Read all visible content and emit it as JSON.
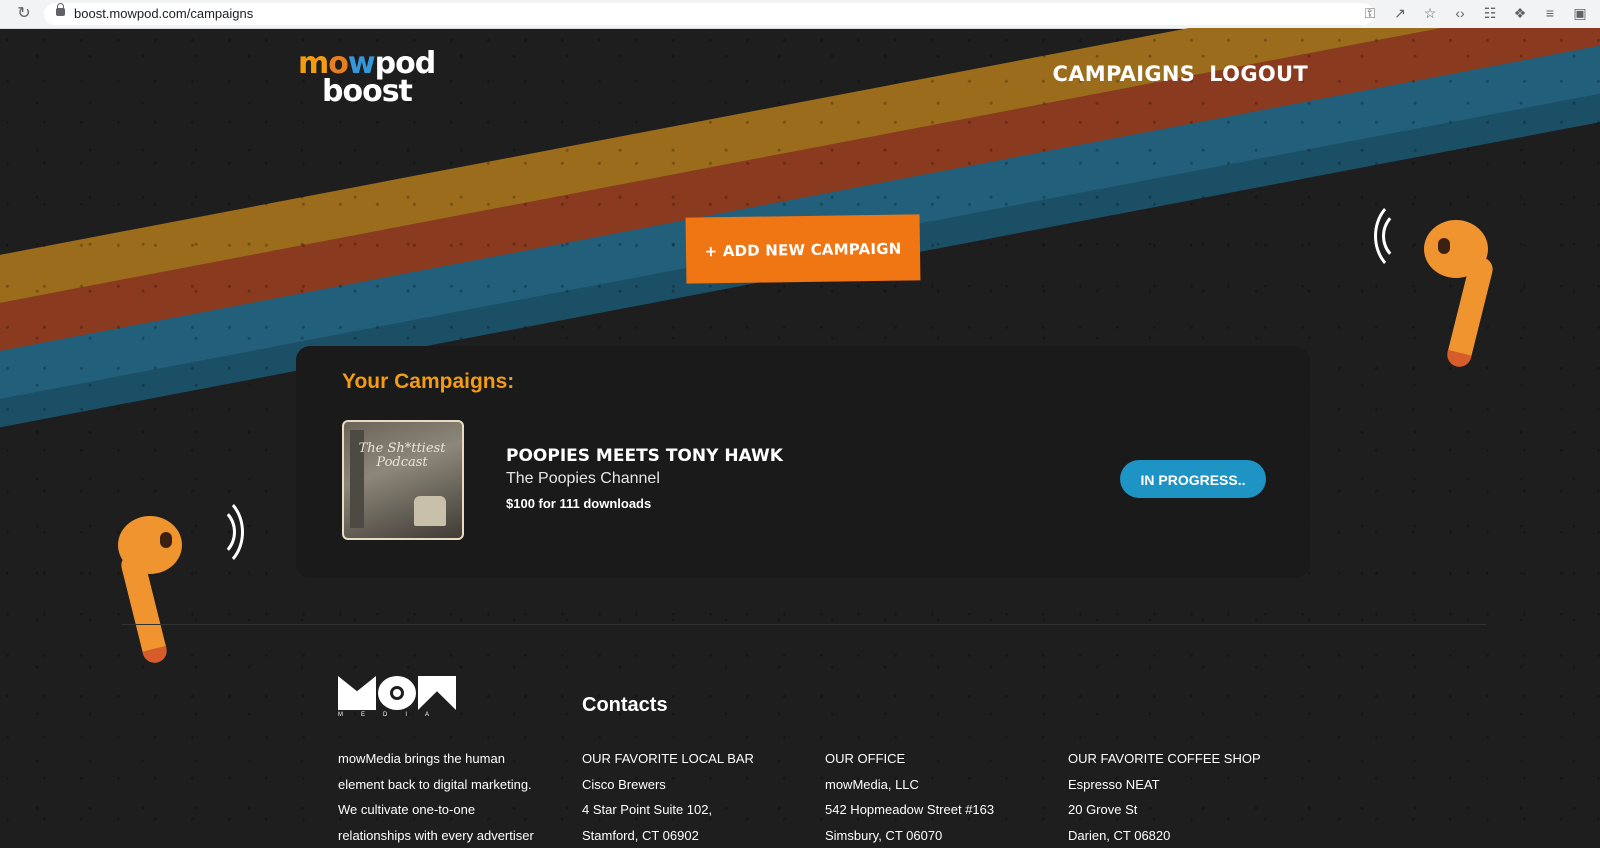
{
  "browser": {
    "url": "boost.mowpod.com/campaigns"
  },
  "header": {
    "logo_line1": "mowpod",
    "logo_line2": "boost",
    "nav": [
      "CAMPAIGNS",
      "LOGOUT"
    ]
  },
  "add_campaign_label": "+ ADD NEW CAMPAIGN",
  "campaigns": {
    "heading": "Your Campaigns:",
    "items": [
      {
        "thumbnail_text": "The Sh*ttiest Podcast",
        "title": "POOPIES MEETS TONY HAWK",
        "channel": "The Poopies Channel",
        "price": "$100 for 111 downloads",
        "status": "IN PROGRESS.."
      }
    ]
  },
  "footer": {
    "brand": "MOW",
    "brand_sub": "MEDIA",
    "about": [
      "mowMedia brings the human",
      "element back to digital marketing.",
      "We cultivate one-to-one",
      "relationships with every advertiser"
    ],
    "contacts_heading": "Contacts",
    "columns": [
      {
        "title": "OUR FAVORITE LOCAL BAR",
        "lines": [
          "Cisco Brewers",
          "4 Star Point Suite 102,",
          "Stamford, CT 06902"
        ]
      },
      {
        "title": "OUR OFFICE",
        "lines": [
          "mowMedia, LLC",
          "542 Hopmeadow Street #163",
          "Simsbury, CT 06070"
        ]
      },
      {
        "title": "OUR FAVORITE COFFEE SHOP",
        "lines": [
          "Espresso NEAT",
          "20 Grove St",
          "Darien, CT 06820"
        ]
      }
    ]
  },
  "colors": {
    "background": "#1e1e1e",
    "accent_orange": "#f07513",
    "heading_gold": "#f39c12",
    "status_blue": "#1e94c4",
    "stripe_gold": "#9a6c1b",
    "stripe_rust": "#8a3a1e",
    "stripe_teal": "#215f7a"
  }
}
